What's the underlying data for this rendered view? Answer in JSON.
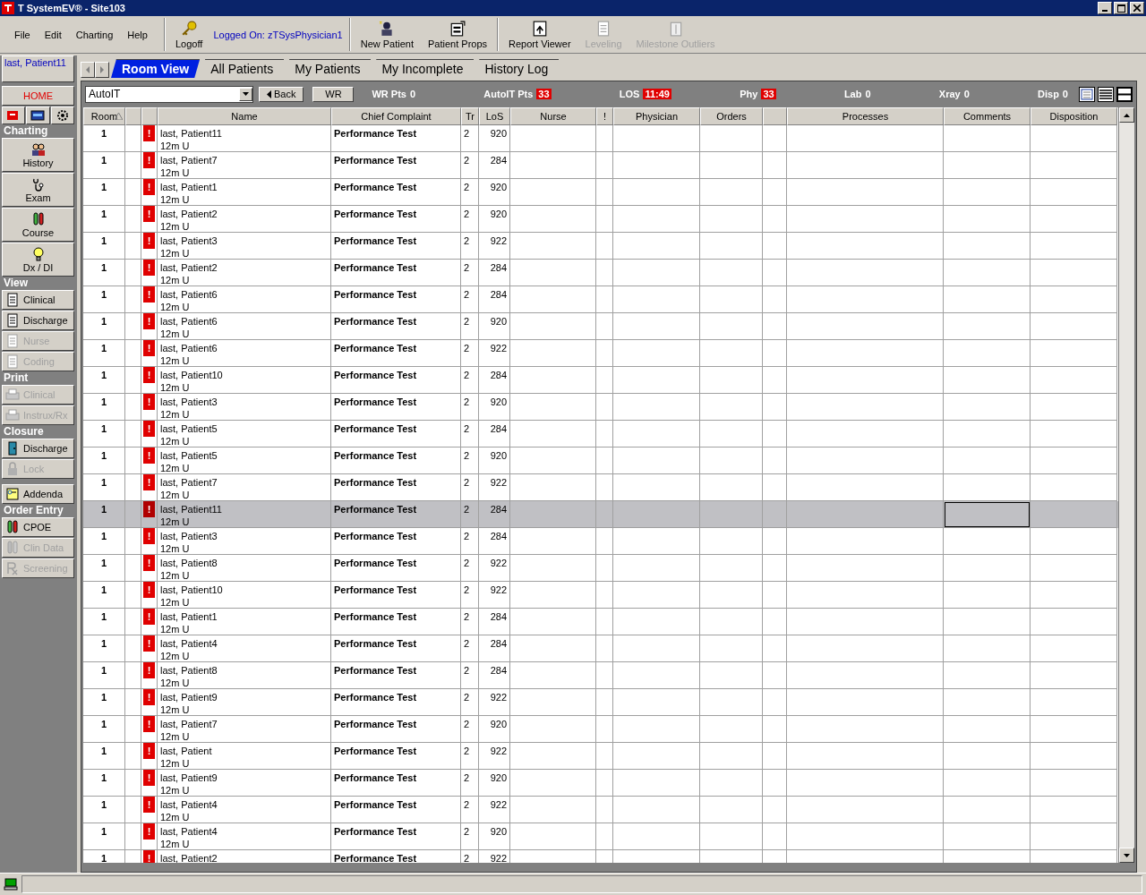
{
  "window": {
    "title": "T SystemEV® - Site103"
  },
  "menu": [
    "File",
    "Edit",
    "Charting",
    "Help"
  ],
  "toolbar": {
    "logoff": "Logoff",
    "logged_on": "Logged On: zTSysPhysician1",
    "buttons": [
      {
        "label": "New Patient",
        "disabled": false
      },
      {
        "label": "Patient Props",
        "disabled": false
      },
      {
        "label": "Report Viewer",
        "disabled": false
      },
      {
        "label": "Leveling",
        "disabled": true
      },
      {
        "label": "Milestone Outliers",
        "disabled": true
      }
    ]
  },
  "sidebar": {
    "patient": "last, Patient11",
    "home": "HOME",
    "sections": [
      {
        "title": "Charting",
        "items": [
          {
            "label": "History",
            "kind": "big",
            "disabled": false
          },
          {
            "label": "Exam",
            "kind": "big",
            "disabled": false
          },
          {
            "label": "Course",
            "kind": "big",
            "disabled": false
          },
          {
            "label": "Dx / DI",
            "kind": "big",
            "disabled": false
          }
        ]
      },
      {
        "title": "View",
        "items": [
          {
            "label": "Clinical",
            "kind": "small",
            "disabled": false
          },
          {
            "label": "Discharge",
            "kind": "small",
            "disabled": false
          },
          {
            "label": "Nurse",
            "kind": "small",
            "disabled": true
          },
          {
            "label": "Coding",
            "kind": "small",
            "disabled": true
          }
        ]
      },
      {
        "title": "Print",
        "items": [
          {
            "label": "Clinical",
            "kind": "small",
            "disabled": true
          },
          {
            "label": "Instrux/Rx",
            "kind": "small",
            "disabled": true
          }
        ]
      },
      {
        "title": "Closure",
        "items": [
          {
            "label": "Discharge",
            "kind": "small",
            "disabled": false
          },
          {
            "label": "Lock",
            "kind": "small",
            "disabled": true
          }
        ]
      },
      {
        "items": [
          {
            "label": "Addenda",
            "kind": "small",
            "disabled": false
          }
        ]
      },
      {
        "title": "Order Entry",
        "items": [
          {
            "label": "CPOE",
            "kind": "small",
            "disabled": false
          },
          {
            "label": "Clin Data",
            "kind": "small",
            "disabled": true
          },
          {
            "label": "Screening",
            "kind": "small",
            "disabled": true
          }
        ]
      }
    ]
  },
  "tabs": [
    {
      "label": "Room View",
      "selected": true
    },
    {
      "label": "All Patients",
      "selected": false
    },
    {
      "label": "My Patients",
      "selected": false
    },
    {
      "label": "My Incomplete",
      "selected": false
    },
    {
      "label": "History Log",
      "selected": false
    }
  ],
  "filter": {
    "dropdown": "AutoIT",
    "back": "Back",
    "wr": "WR",
    "stats": [
      {
        "label": "WR Pts",
        "value": "0",
        "alert": false
      },
      {
        "label": "AutoIT Pts",
        "value": "33",
        "alert": true
      },
      {
        "label": "LOS",
        "value": "11:49",
        "alert": true
      },
      {
        "label": "Phy",
        "value": "33",
        "alert": true
      },
      {
        "label": "Lab",
        "value": "0",
        "alert": false
      },
      {
        "label": "Xray",
        "value": "0",
        "alert": false
      },
      {
        "label": "Disp",
        "value": "0",
        "alert": false
      }
    ]
  },
  "table": {
    "columns": [
      {
        "kind": "text",
        "label": "Room",
        "sorted": true
      },
      {
        "kind": "blank"
      },
      {
        "kind": "blank"
      },
      {
        "kind": "text",
        "label": "Name",
        "sorted": false
      },
      {
        "kind": "text",
        "label": "Chief Complaint",
        "sorted": false
      },
      {
        "kind": "text",
        "label": "Tr",
        "sorted": false
      },
      {
        "kind": "text",
        "label": "LoS",
        "sorted": false
      },
      {
        "kind": "text",
        "label": "Nurse",
        "sorted": false
      },
      {
        "kind": "text",
        "label": "!",
        "sorted": false
      },
      {
        "kind": "text",
        "label": "Physician",
        "sorted": false
      },
      {
        "kind": "text",
        "label": "Orders",
        "sorted": false
      },
      {
        "kind": "blank"
      },
      {
        "kind": "text",
        "label": "Processes",
        "sorted": false
      },
      {
        "kind": "text",
        "label": "Comments",
        "sorted": false
      },
      {
        "kind": "text",
        "label": "Disposition",
        "sorted": false
      }
    ],
    "rows": [
      {
        "room": "1",
        "alert": "!",
        "name": "last, Patient11",
        "sub": "12m U",
        "complaint": "Performance Test",
        "tr": "2",
        "los": "920",
        "selected": false
      },
      {
        "room": "1",
        "alert": "!",
        "name": "last, Patient7",
        "sub": "12m U",
        "complaint": "Performance Test",
        "tr": "2",
        "los": "284",
        "selected": false
      },
      {
        "room": "1",
        "alert": "!",
        "name": "last, Patient1",
        "sub": "12m U",
        "complaint": "Performance Test",
        "tr": "2",
        "los": "920",
        "selected": false
      },
      {
        "room": "1",
        "alert": "!",
        "name": "last, Patient2",
        "sub": "12m U",
        "complaint": "Performance Test",
        "tr": "2",
        "los": "920",
        "selected": false
      },
      {
        "room": "1",
        "alert": "!",
        "name": "last, Patient3",
        "sub": "12m U",
        "complaint": "Performance Test",
        "tr": "2",
        "los": "922",
        "selected": false
      },
      {
        "room": "1",
        "alert": "!",
        "name": "last, Patient2",
        "sub": "12m U",
        "complaint": "Performance Test",
        "tr": "2",
        "los": "284",
        "selected": false
      },
      {
        "room": "1",
        "alert": "!",
        "name": "last, Patient6",
        "sub": "12m U",
        "complaint": "Performance Test",
        "tr": "2",
        "los": "284",
        "selected": false
      },
      {
        "room": "1",
        "alert": "!",
        "name": "last, Patient6",
        "sub": "12m U",
        "complaint": "Performance Test",
        "tr": "2",
        "los": "920",
        "selected": false
      },
      {
        "room": "1",
        "alert": "!",
        "name": "last, Patient6",
        "sub": "12m U",
        "complaint": "Performance Test",
        "tr": "2",
        "los": "922",
        "selected": false
      },
      {
        "room": "1",
        "alert": "!",
        "name": "last, Patient10",
        "sub": "12m U",
        "complaint": "Performance Test",
        "tr": "2",
        "los": "284",
        "selected": false
      },
      {
        "room": "1",
        "alert": "!",
        "name": "last, Patient3",
        "sub": "12m U",
        "complaint": "Performance Test",
        "tr": "2",
        "los": "920",
        "selected": false
      },
      {
        "room": "1",
        "alert": "!",
        "name": "last, Patient5",
        "sub": "12m U",
        "complaint": "Performance Test",
        "tr": "2",
        "los": "284",
        "selected": false
      },
      {
        "room": "1",
        "alert": "!",
        "name": "last, Patient5",
        "sub": "12m U",
        "complaint": "Performance Test",
        "tr": "2",
        "los": "920",
        "selected": false
      },
      {
        "room": "1",
        "alert": "!",
        "name": "last, Patient7",
        "sub": "12m U",
        "complaint": "Performance Test",
        "tr": "2",
        "los": "922",
        "selected": false
      },
      {
        "room": "1",
        "alert": "!",
        "name": "last, Patient11",
        "sub": "12m U",
        "complaint": "Performance Test",
        "tr": "2",
        "los": "284",
        "selected": true
      },
      {
        "room": "1",
        "alert": "!",
        "name": "last, Patient3",
        "sub": "12m U",
        "complaint": "Performance Test",
        "tr": "2",
        "los": "284",
        "selected": false
      },
      {
        "room": "1",
        "alert": "!",
        "name": "last, Patient8",
        "sub": "12m U",
        "complaint": "Performance Test",
        "tr": "2",
        "los": "922",
        "selected": false
      },
      {
        "room": "1",
        "alert": "!",
        "name": "last, Patient10",
        "sub": "12m U",
        "complaint": "Performance Test",
        "tr": "2",
        "los": "922",
        "selected": false
      },
      {
        "room": "1",
        "alert": "!",
        "name": "last, Patient1",
        "sub": "12m U",
        "complaint": "Performance Test",
        "tr": "2",
        "los": "284",
        "selected": false
      },
      {
        "room": "1",
        "alert": "!",
        "name": "last, Patient4",
        "sub": "12m U",
        "complaint": "Performance Test",
        "tr": "2",
        "los": "284",
        "selected": false
      },
      {
        "room": "1",
        "alert": "!",
        "name": "last, Patient8",
        "sub": "12m U",
        "complaint": "Performance Test",
        "tr": "2",
        "los": "284",
        "selected": false
      },
      {
        "room": "1",
        "alert": "!",
        "name": "last, Patient9",
        "sub": "12m U",
        "complaint": "Performance Test",
        "tr": "2",
        "los": "922",
        "selected": false
      },
      {
        "room": "1",
        "alert": "!",
        "name": "last, Patient7",
        "sub": "12m U",
        "complaint": "Performance Test",
        "tr": "2",
        "los": "920",
        "selected": false
      },
      {
        "room": "1",
        "alert": "!",
        "name": "last, Patient",
        "sub": "12m U",
        "complaint": "Performance Test",
        "tr": "2",
        "los": "922",
        "selected": false
      },
      {
        "room": "1",
        "alert": "!",
        "name": "last, Patient9",
        "sub": "12m U",
        "complaint": "Performance Test",
        "tr": "2",
        "los": "920",
        "selected": false
      },
      {
        "room": "1",
        "alert": "!",
        "name": "last, Patient4",
        "sub": "12m U",
        "complaint": "Performance Test",
        "tr": "2",
        "los": "922",
        "selected": false
      },
      {
        "room": "1",
        "alert": "!",
        "name": "last, Patient4",
        "sub": "12m U",
        "complaint": "Performance Test",
        "tr": "2",
        "los": "920",
        "selected": false
      },
      {
        "room": "1",
        "alert": "!",
        "name": "last, Patient2",
        "complaint": "Performance Test",
        "tr": "2",
        "los": "922",
        "selected": false
      }
    ]
  }
}
